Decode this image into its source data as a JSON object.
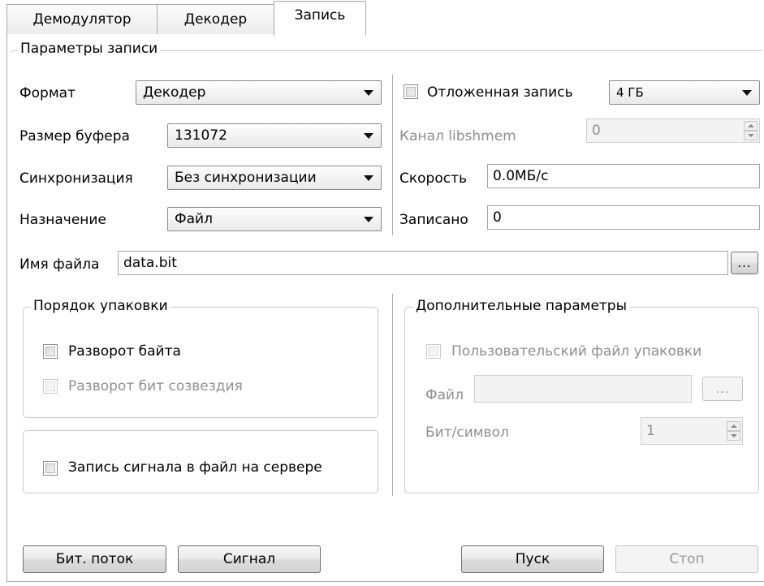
{
  "tabs": [
    "Демодулятор",
    "Декодер",
    "Запись"
  ],
  "record_params": {
    "title": "Параметры записи",
    "format_label": "Формат",
    "format_value": "Декодер",
    "buffer_label": "Размер буфера",
    "buffer_value": "131072",
    "sync_label": "Синхронизация",
    "sync_value": "Без синхронизации",
    "dest_label": "Назначение",
    "dest_value": "Файл",
    "delayed_label": "Отложенная запись",
    "delayed_size": "4 ГБ",
    "channel_label": "Канал libshmem",
    "channel_value": "0",
    "speed_label": "Скорость",
    "speed_value": "0.0МБ/с",
    "written_label": "Записано",
    "written_value": "0",
    "filename_label": "Имя файла",
    "filename_value": "data.bit",
    "browse_label": "..."
  },
  "packing": {
    "title": "Порядок упаковки",
    "byte_reverse": "Разворот байта",
    "constellation_reverse": "Разворот бит созвездия"
  },
  "server_record": {
    "label": "Запись сигнала в файл на сервере"
  },
  "extra": {
    "title": "Дополнительные параметры",
    "custom_file": "Пользовательский файл упаковки",
    "file_label": "Файл",
    "file_browse": "...",
    "bits_label": "Бит/символ",
    "bits_value": "1"
  },
  "buttons": {
    "bitstream": "Бит. поток",
    "signal": "Сигнал",
    "start": "Пуск",
    "stop": "Стоп"
  }
}
